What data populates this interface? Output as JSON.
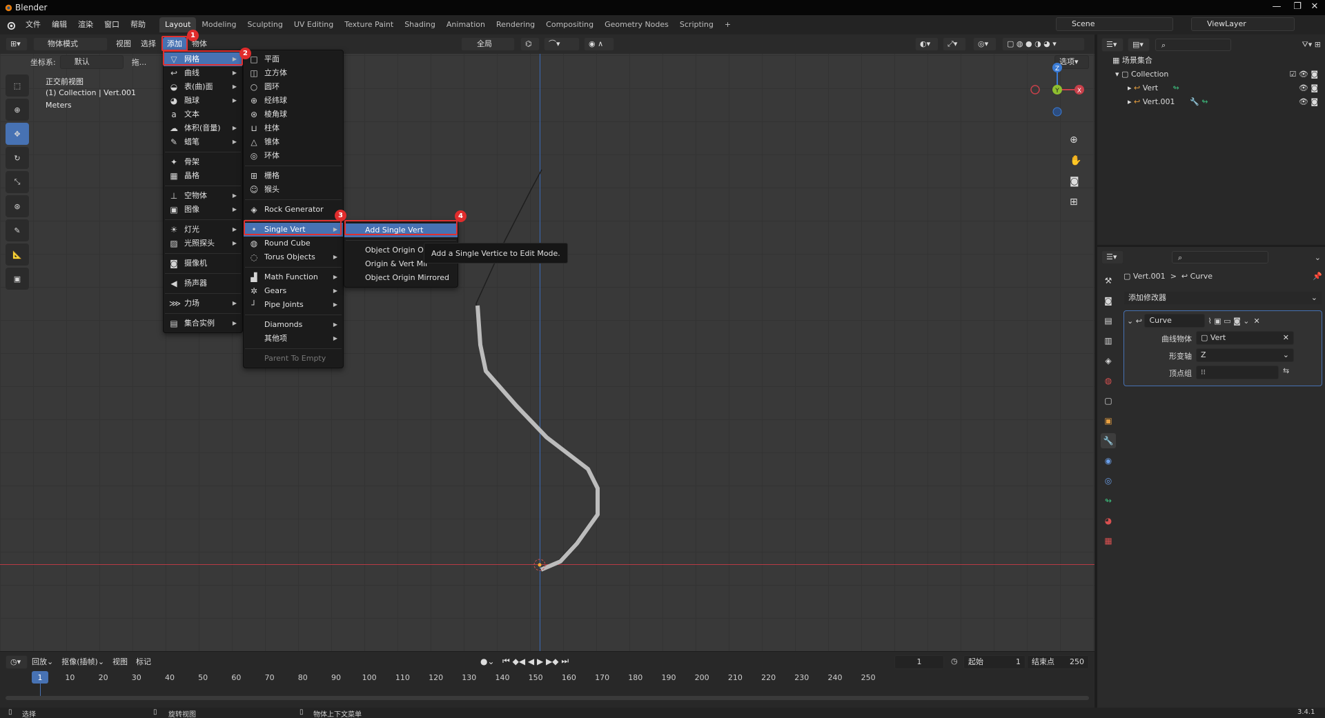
{
  "app": {
    "title": "Blender",
    "version": "3.4.1"
  },
  "topmenu": {
    "file": "文件",
    "edit": "编辑",
    "render": "渲染",
    "window": "窗口",
    "help": "帮助"
  },
  "workspaces": [
    "Layout",
    "Modeling",
    "Sculpting",
    "UV Editing",
    "Texture Paint",
    "Shading",
    "Animation",
    "Rendering",
    "Compositing",
    "Geometry Nodes",
    "Scripting"
  ],
  "add_workspace": "+",
  "scene": {
    "name": "Scene",
    "view_layer": "ViewLayer"
  },
  "viewport_header": {
    "mode": "物体模式",
    "view": "视图",
    "select": "选择",
    "add": "添加",
    "object": "物体",
    "orientation": "全局",
    "options": "选项",
    "coord_label": "坐标系:",
    "coord_value": "默认",
    "drag": "拖..."
  },
  "viewport_overlay": {
    "view_name": "正交前视图",
    "collection": "(1) Collection | Vert.001",
    "units": "Meters"
  },
  "gizmo": {
    "z": "Z",
    "y": "Y",
    "x": "X"
  },
  "add_menu": {
    "items": [
      {
        "label": "网格",
        "icon": "mesh-icon",
        "glyph": "▽",
        "submenu": true
      },
      {
        "label": "曲线",
        "icon": "curve-icon",
        "glyph": "↩",
        "submenu": true
      },
      {
        "label": "表(曲)面",
        "icon": "surface-icon",
        "glyph": "◒",
        "submenu": true
      },
      {
        "label": "融球",
        "icon": "metaball-icon",
        "glyph": "◕",
        "submenu": true
      },
      {
        "label": "文本",
        "icon": "text-icon",
        "glyph": "a",
        "submenu": false
      },
      {
        "label": "体积(音量)",
        "icon": "volume-icon",
        "glyph": "☁",
        "submenu": true
      },
      {
        "label": "蜡笔",
        "icon": "grease-pencil-icon",
        "glyph": "✎",
        "submenu": true
      },
      {
        "label": "骨架",
        "icon": "armature-icon",
        "glyph": "✦",
        "submenu": false
      },
      {
        "label": "晶格",
        "icon": "lattice-icon",
        "glyph": "▦",
        "submenu": false
      },
      {
        "label": "空物体",
        "icon": "empty-icon",
        "glyph": "⊥",
        "submenu": true
      },
      {
        "label": "图像",
        "icon": "image-icon",
        "glyph": "▣",
        "submenu": true
      },
      {
        "label": "灯光",
        "icon": "light-icon",
        "glyph": "☀",
        "submenu": true
      },
      {
        "label": "光照探头",
        "icon": "light-probe-icon",
        "glyph": "▨",
        "submenu": true
      },
      {
        "label": "摄像机",
        "icon": "camera-icon",
        "glyph": "◙",
        "submenu": false
      },
      {
        "label": "扬声器",
        "icon": "speaker-icon",
        "glyph": "◀",
        "submenu": false
      },
      {
        "label": "力场",
        "icon": "force-field-icon",
        "glyph": "⋙",
        "submenu": true
      },
      {
        "label": "集合实例",
        "icon": "collection-instance-icon",
        "glyph": "▤",
        "submenu": true
      }
    ]
  },
  "mesh_menu": {
    "items": [
      {
        "label": "平面",
        "icon": "plane-icon",
        "glyph": "□"
      },
      {
        "label": "立方体",
        "icon": "cube-icon",
        "glyph": "◫"
      },
      {
        "label": "圆环",
        "icon": "circle-icon",
        "glyph": "○"
      },
      {
        "label": "经纬球",
        "icon": "uv-sphere-icon",
        "glyph": "⊕"
      },
      {
        "label": "棱角球",
        "icon": "ico-sphere-icon",
        "glyph": "⊛"
      },
      {
        "label": "柱体",
        "icon": "cylinder-icon",
        "glyph": "⊔"
      },
      {
        "label": "锥体",
        "icon": "cone-icon",
        "glyph": "△"
      },
      {
        "label": "环体",
        "icon": "torus-icon",
        "glyph": "◎"
      },
      {
        "label": "栅格",
        "icon": "grid-icon",
        "glyph": "⊞"
      },
      {
        "label": "猴头",
        "icon": "monkey-icon",
        "glyph": "☺"
      },
      {
        "label": "Rock Generator",
        "icon": "rock-icon",
        "glyph": "◈"
      },
      {
        "label": "Single Vert",
        "icon": "vertex-icon",
        "glyph": "•"
      },
      {
        "label": "Round Cube",
        "icon": "round-cube-icon",
        "glyph": "◍"
      },
      {
        "label": "Torus Objects",
        "icon": "torus-objects-icon",
        "glyph": "◌"
      },
      {
        "label": "Math Function",
        "icon": "math-function-icon",
        "glyph": "▟"
      },
      {
        "label": "Gears",
        "icon": "gear-icon",
        "glyph": "✲"
      },
      {
        "label": "Pipe Joints",
        "icon": "pipe-joints-icon",
        "glyph": "┘"
      },
      {
        "label": "Diamonds",
        "icon": "diamonds-icon",
        "glyph": ""
      },
      {
        "label": "其他项",
        "icon": "extras-icon",
        "glyph": ""
      },
      {
        "label": "Parent To Empty",
        "icon": "",
        "glyph": ""
      }
    ]
  },
  "single_vert_menu": {
    "items": [
      "Add Single Vert",
      "Object Origin On",
      "Origin & Vert Mir",
      "Object Origin Mirrored"
    ]
  },
  "tooltip": "Add a Single Vertice to Edit Mode.",
  "badges": [
    "1",
    "2",
    "3",
    "4"
  ],
  "outliner": {
    "root": "场景集合",
    "collection": "Collection",
    "objects": [
      "Vert",
      "Vert.001"
    ]
  },
  "properties": {
    "breadcrumb_object": "Vert.001",
    "breadcrumb_sep": ">",
    "breadcrumb_modifier": "Curve",
    "add_modifier": "添加修改器",
    "modifier_name": "Curve",
    "curve_object_label": "曲线物体",
    "curve_object_value": "Vert",
    "deform_axis_label": "形变轴",
    "deform_axis_value": "Z",
    "vertex_group_label": "顶点组"
  },
  "timeline": {
    "playback": "回放",
    "keying": "抠像(插帧)",
    "view": "视图",
    "marker": "标记",
    "current_frame": "1",
    "start_label": "起始",
    "start_value": "1",
    "end_label": "结束点",
    "end_value": "250",
    "ticks": [
      "1",
      "10",
      "20",
      "30",
      "40",
      "50",
      "60",
      "70",
      "80",
      "90",
      "100",
      "110",
      "120",
      "130",
      "140",
      "150",
      "160",
      "170",
      "180",
      "190",
      "200",
      "210",
      "220",
      "230",
      "240",
      "250"
    ]
  },
  "statusbar": {
    "select": "选择",
    "rotate": "旋转视图",
    "context": "物体上下文菜单"
  },
  "colors": {
    "accent": "#4772b3",
    "highlight_box": "#e03030",
    "axis_x": "#c8404a",
    "axis_y": "#8fbf2f",
    "axis_z": "#3a7bd5"
  }
}
